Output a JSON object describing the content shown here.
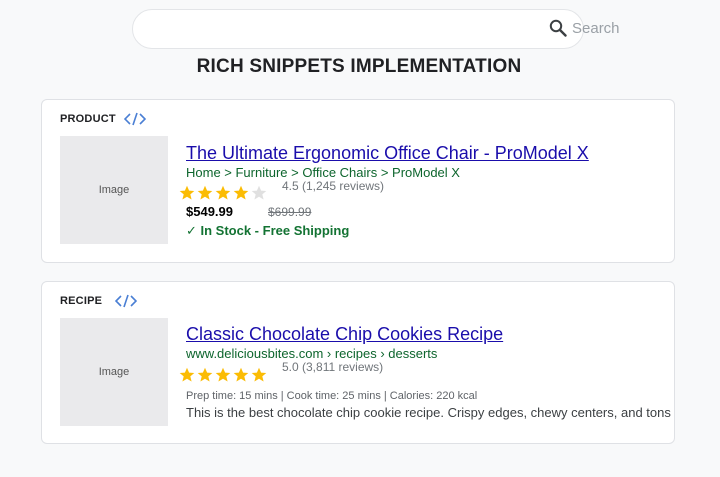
{
  "search": {
    "placeholder": "Search"
  },
  "page": {
    "title": "RICH SNIPPETS IMPLEMENTATION"
  },
  "colors": {
    "link": "#1a0dab",
    "url": "#0d652d",
    "star": "#fbbc04",
    "stock": "#137333",
    "code_icon": "#4a7fd4"
  },
  "product": {
    "type_label": "PRODUCT",
    "image_label": "Image",
    "title": "The Ultimate Ergonomic Office Chair - ProModel X",
    "breadcrumb": "Home > Furniture > Office Chairs > ProModel X",
    "rating": 4.5,
    "rating_text": "4.5 (1,245 reviews)",
    "price": "$549.99",
    "old_price": "$699.99",
    "availability": "✓ In Stock - Free Shipping"
  },
  "recipe": {
    "type_label": "RECIPE",
    "image_label": "Image",
    "title": "Classic Chocolate Chip Cookies Recipe",
    "breadcrumb": "www.deliciousbites.com › recipes › desserts",
    "rating": 5.0,
    "rating_text": "5.0 (3,811 reviews)",
    "meta": "Prep time: 15 mins | Cook time: 25 mins | Calories: 220 kcal",
    "description": "This is the best chocolate chip cookie recipe. Crispy edges, chewy centers, and tons of chocolate"
  }
}
